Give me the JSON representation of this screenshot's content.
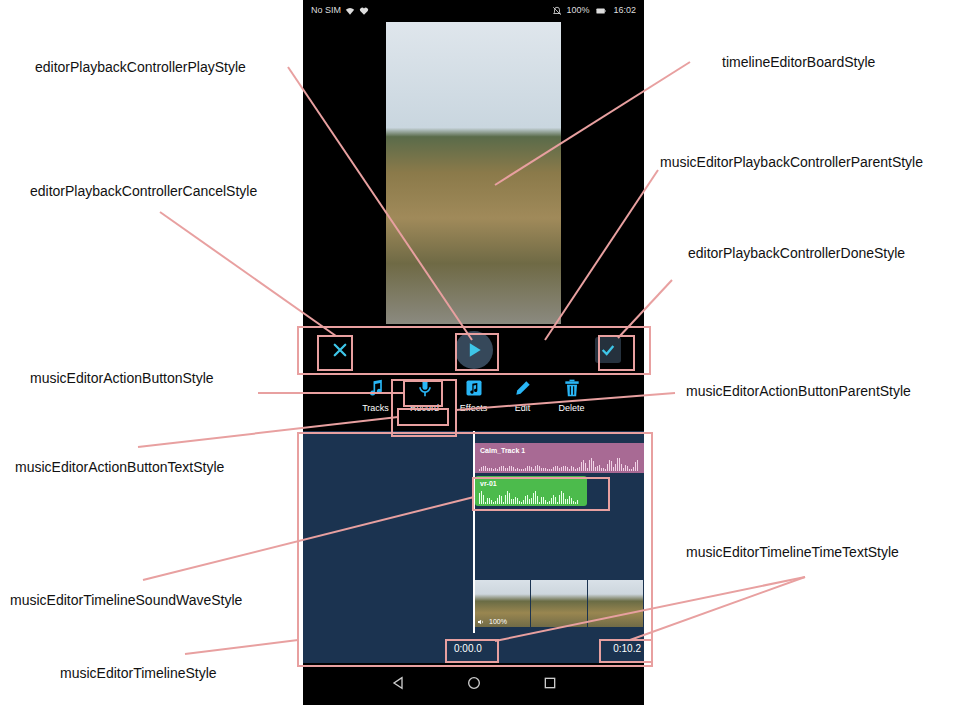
{
  "status_bar": {
    "carrier": "No SIM",
    "battery": "100%",
    "time": "16:02"
  },
  "actions": [
    {
      "label": "Tracks"
    },
    {
      "label": "Record"
    },
    {
      "label": "Effects"
    },
    {
      "label": "Edit"
    },
    {
      "label": "Delete"
    }
  ],
  "tracks": [
    {
      "label": "Calm_Track 1",
      "color": "#a86a94"
    },
    {
      "label": "vr-01",
      "color": "#4cbb4c"
    }
  ],
  "video_track": {
    "volume": "100%"
  },
  "timeline": {
    "start": "0:00.0",
    "end": "0:10.2"
  },
  "annotations": [
    {
      "label": "editorPlaybackControllerPlayStyle"
    },
    {
      "label": "timelineEditorBoardStyle"
    },
    {
      "label": "musicEditorPlaybackControllerParentStyle"
    },
    {
      "label": "editorPlaybackControllerCancelStyle"
    },
    {
      "label": "editorPlaybackControllerDoneStyle"
    },
    {
      "label": "musicEditorActionButtonStyle"
    },
    {
      "label": "musicEditorActionButtonParentStyle"
    },
    {
      "label": "musicEditorActionButtonTextStyle"
    },
    {
      "label": "musicEditorTimelineSoundWaveStyle"
    },
    {
      "label": "musicEditorTimelineStyle"
    },
    {
      "label": "musicEditorTimelineTimeTextStyle"
    }
  ]
}
